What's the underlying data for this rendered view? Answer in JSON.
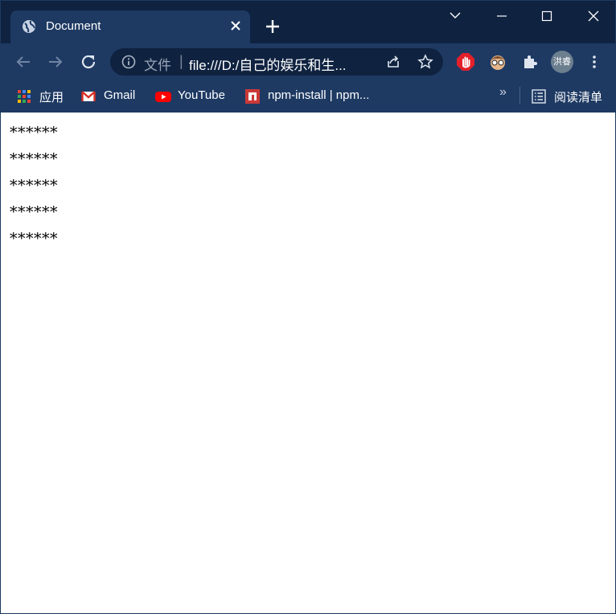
{
  "tab": {
    "title": "Document"
  },
  "window_controls": {
    "chevron": "chevron-down-icon",
    "minimize": "minimize-icon",
    "maximize": "maximize-icon",
    "close": "close-icon"
  },
  "omnibox": {
    "scheme": "文件",
    "separator": "|",
    "url": "file:///D:/自己的娱乐和生..."
  },
  "profile": {
    "name": "洪睿"
  },
  "bookmarks": {
    "items": [
      {
        "label": "应用",
        "icon": "apps-grid-icon"
      },
      {
        "label": "Gmail",
        "icon": "gmail-icon"
      },
      {
        "label": "YouTube",
        "icon": "youtube-icon"
      },
      {
        "label": "npm-install | npm...",
        "icon": "npm-icon"
      }
    ],
    "more": "»",
    "reading_list": "阅读清单"
  },
  "content": {
    "lines": [
      "******",
      "******",
      "******",
      "******",
      "******"
    ]
  },
  "colors": {
    "frame": "#0f2240",
    "toolbar": "#1e3a63",
    "page": "#ffffff"
  }
}
